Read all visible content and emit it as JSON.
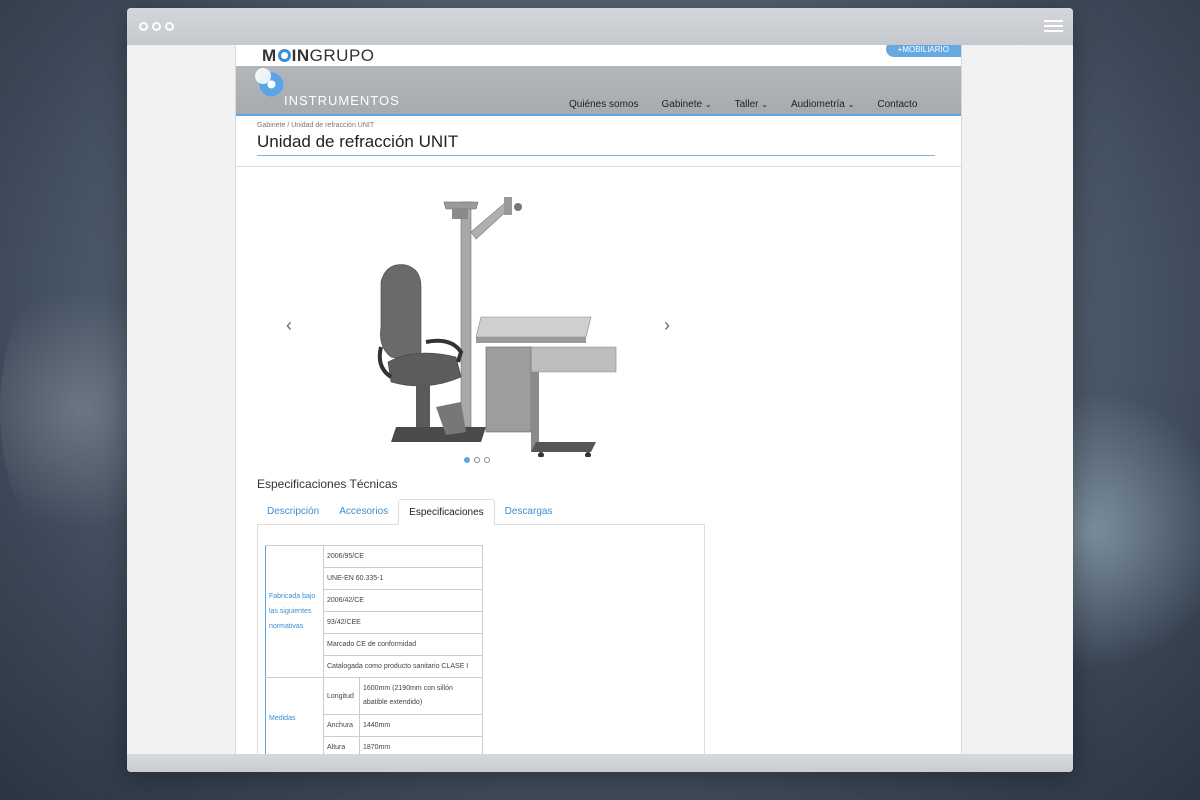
{
  "window": {
    "menu_icon": "hamburger-icon"
  },
  "site": {
    "logo_prefix": "M",
    "logo_middle": "IN",
    "logo_suffix": "GRUPO",
    "mobiliario_button": "+MOBILIARIO",
    "brand": "INSTRUMENTOS",
    "nav": [
      {
        "label": "Quiénes somos",
        "dropdown": false
      },
      {
        "label": "Gabinete",
        "dropdown": true
      },
      {
        "label": "Taller",
        "dropdown": true
      },
      {
        "label": "Audiometría",
        "dropdown": true
      },
      {
        "label": "Contacto",
        "dropdown": false
      }
    ]
  },
  "page": {
    "breadcrumb": "Gabinete / Unidad de refracción UNIT",
    "title": "Unidad de refracción UNIT"
  },
  "carousel": {
    "prev": "‹",
    "next": "›",
    "slides": 3,
    "active": 0
  },
  "specs": {
    "heading": "Especificaciones Técnicas",
    "tabs": [
      "Descripción",
      "Accesorios",
      "Especificaciones",
      "Descargas"
    ],
    "active_tab": 2,
    "table": {
      "group1": {
        "label": "Fabricada bajo las siguientes normativas",
        "values": [
          "2006/95/CE",
          "UNE-EN 60.335-1",
          "2006/42/CE",
          "93/42/CEE",
          "Marcado CE de conformidad",
          "Catalogada como producto sanitario CLASE I"
        ]
      },
      "group2": {
        "label": "Medidas",
        "rows": [
          {
            "name": "Longitud",
            "value": "1600mm (2190mm con sillón abatible extendido)"
          },
          {
            "name": "Anchura",
            "value": "1440mm"
          },
          {
            "name": "Altura",
            "value": "1870mm"
          }
        ]
      }
    }
  },
  "colors": {
    "accent": "#3a8fd6",
    "band": "#a9acb0"
  }
}
